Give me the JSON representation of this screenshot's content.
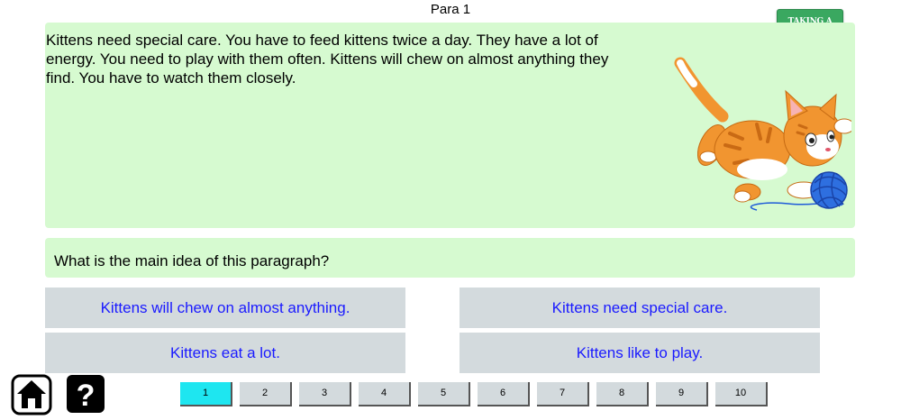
{
  "header": {
    "title": "Para 1",
    "break_button": "TAKING A BREAK"
  },
  "passage": {
    "text": "Kittens need special care. You have to feed kittens twice a day. They have a lot of energy. You need to play with them often. Kittens will chew on almost anything they find. You have to watch them closely."
  },
  "question": {
    "text": "What is the main idea of this paragraph?"
  },
  "answers": [
    "Kittens will chew on almost anything.",
    "Kittens need special care.",
    "Kittens eat a lot.",
    "Kittens like to play."
  ],
  "pagination": {
    "pages": [
      "1",
      "2",
      "3",
      "4",
      "5",
      "6",
      "7",
      "8",
      "9",
      "10"
    ],
    "current": "1"
  },
  "colors": {
    "passage_bg": "#d6fad0",
    "answer_bg": "#d3dadd",
    "answer_text": "#1a1aff",
    "active_page": "#1ee6f0",
    "break_button": "#3aa860"
  },
  "icons": {
    "home": "home-icon",
    "help": "question-mark-icon",
    "illustration": "kitten-with-yarn"
  }
}
